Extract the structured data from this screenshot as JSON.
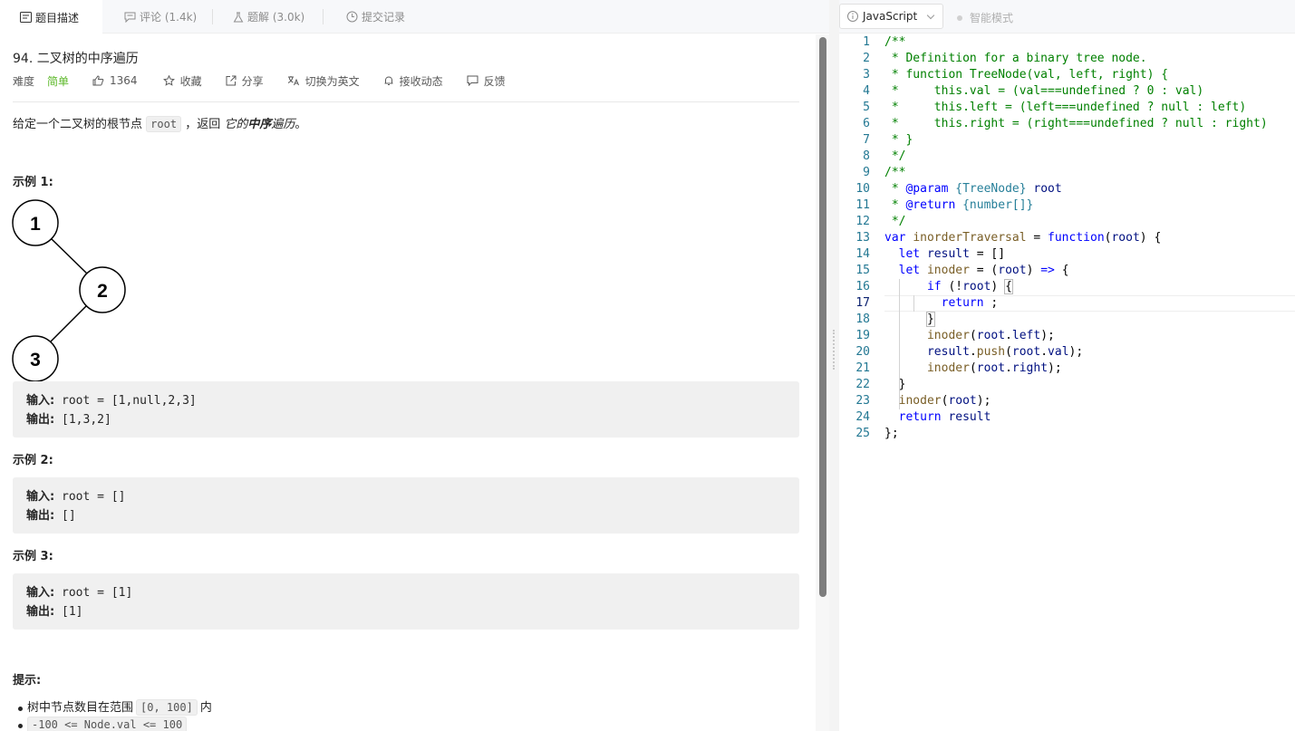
{
  "tabs": [
    {
      "label": "题目描述",
      "icon": "description-icon"
    },
    {
      "label": "评论 (1.4k)",
      "icon": "comment-icon"
    },
    {
      "label": "题解 (3.0k)",
      "icon": "flask-icon"
    },
    {
      "label": "提交记录",
      "icon": "clock-icon"
    }
  ],
  "problem": {
    "title": "94. 二叉树的中序遍历",
    "difficulty_label": "难度",
    "difficulty": "简单",
    "likes": "1364",
    "favorite": "收藏",
    "share": "分享",
    "switch_lang": "切换为英文",
    "subscribe": "接收动态",
    "feedback": "反馈",
    "desc_prefix": "给定一个二叉树的根节点",
    "desc_code": "root",
    "desc_mid": "，返回",
    "desc_em1": "它的",
    "desc_strong": "中序",
    "desc_em2": "遍历",
    "desc_suffix": "。"
  },
  "tree": {
    "nodes": [
      "1",
      "2",
      "3"
    ]
  },
  "examples": [
    {
      "title": "示例 1:",
      "input_label": "输入:",
      "input": "root = [1,null,2,3]",
      "output_label": "输出:",
      "output": "[1,3,2]"
    },
    {
      "title": "示例 2:",
      "input_label": "输入:",
      "input": "root = []",
      "output_label": "输出:",
      "output": "[]"
    },
    {
      "title": "示例 3:",
      "input_label": "输入:",
      "input": "root = [1]",
      "output_label": "输出:",
      "output": "[1]"
    }
  ],
  "hints": {
    "title": "提示:",
    "items": [
      {
        "prefix": "树中节点数目在范围",
        "code": "[0, 100]",
        "suffix": "内"
      },
      {
        "prefix": "",
        "code": "-100 <= Node.val <= 100",
        "suffix": ""
      }
    ]
  },
  "editor": {
    "language": "JavaScript",
    "smart_mode": "智能模式",
    "current_line": 17,
    "line_numbers": [
      "1",
      "2",
      "3",
      "4",
      "5",
      "6",
      "7",
      "8",
      "9",
      "10",
      "11",
      "12",
      "13",
      "14",
      "15",
      "16",
      "17",
      "18",
      "19",
      "20",
      "21",
      "22",
      "23",
      "24",
      "25"
    ]
  },
  "colors": {
    "easy": "#5ab726",
    "comment": "#008000",
    "keyword": "#0000ff",
    "function": "#795e26",
    "variable": "#001080",
    "type": "#267f99"
  }
}
